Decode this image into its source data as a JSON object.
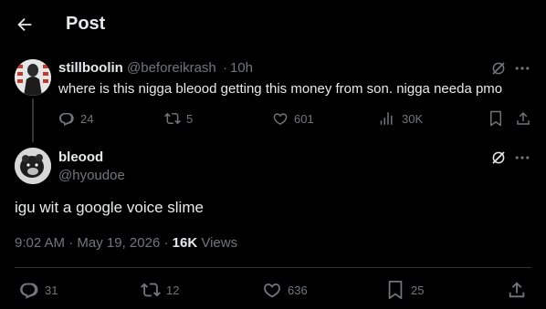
{
  "header": {
    "title": "Post",
    "back_icon": "arrow-left-icon"
  },
  "parent_post": {
    "display_name": "stillboolin",
    "handle": "@beforeikrash",
    "separator": "·",
    "time": "10h",
    "text": "where is this nigga bleood getting this money from son. nigga needa pmo",
    "actions": {
      "replies": "24",
      "reposts": "5",
      "likes": "601",
      "views": "30K"
    }
  },
  "main_post": {
    "display_name": "bleood",
    "handle": "@hyoudoe",
    "text": "igu wit a google voice slime",
    "time": "9:02 AM",
    "date": "May 19, 2026",
    "separator": "·",
    "views_count": "16K",
    "views_label": "Views",
    "actions": {
      "replies": "31",
      "reposts": "12",
      "likes": "636",
      "bookmarks": "25"
    }
  },
  "colors": {
    "background": "#000000",
    "text": "#e7e9ea",
    "muted": "#71767b",
    "divider": "#2f3336"
  }
}
